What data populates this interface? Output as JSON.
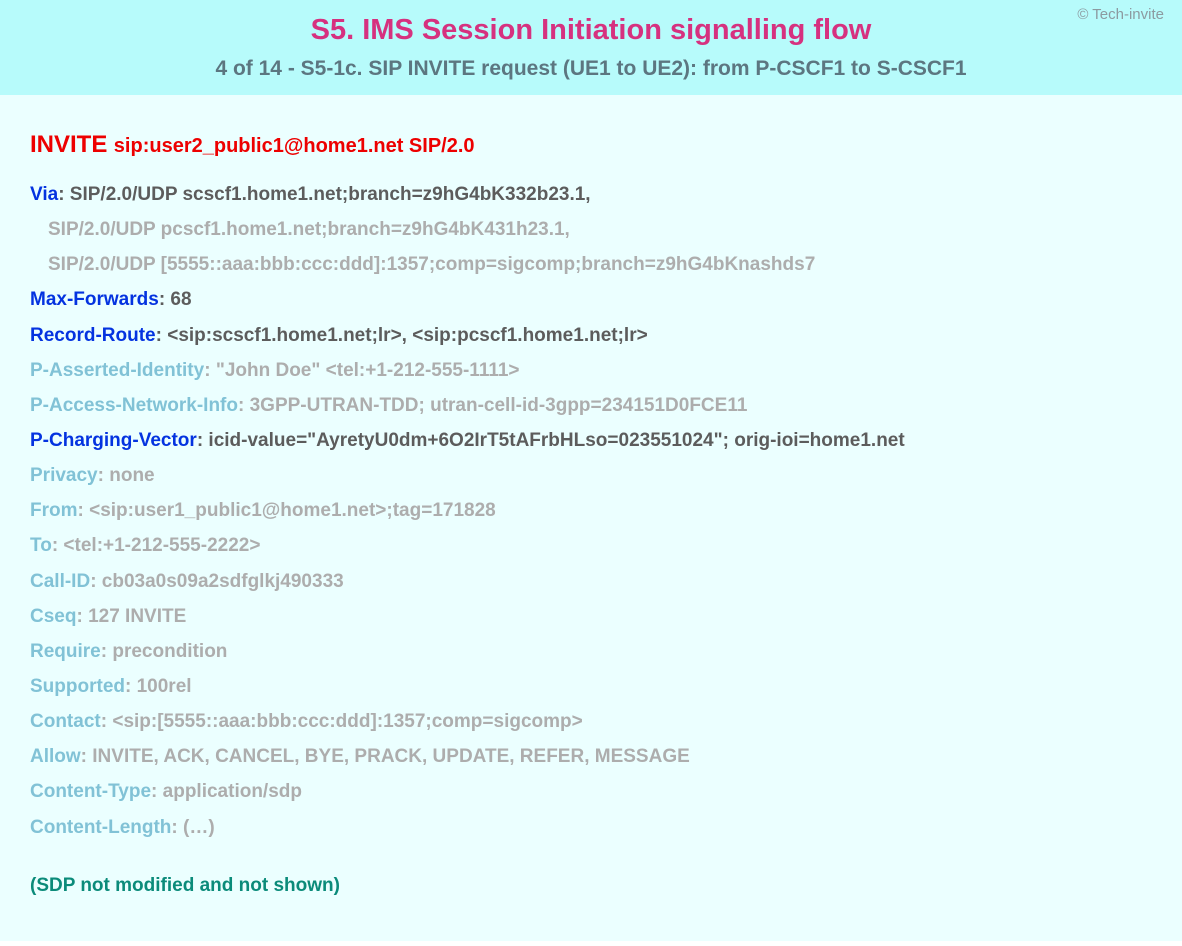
{
  "copyright": "© Tech-invite",
  "title_main": "S5. IMS Session Initiation signalling flow",
  "title_sub": "4 of 14 - S5-1c. SIP INVITE request (UE1 to UE2): from P-CSCF1 to S-CSCF1",
  "request": {
    "method": "INVITE",
    "uri": "sip:user2_public1@home1.net SIP/2.0"
  },
  "headers": [
    {
      "name": "Via",
      "value": "SIP/2.0/UDP scscf1.home1.net;branch=z9hG4bK332b23.1,",
      "nstyle": "k-blue",
      "vstyle": "v-dark",
      "colon": "colon-dark",
      "cont": false
    },
    {
      "name": "",
      "value": "SIP/2.0/UDP pcscf1.home1.net;branch=z9hG4bK431h23.1,",
      "nstyle": "",
      "vstyle": "v-grey",
      "colon": "",
      "cont": true
    },
    {
      "name": "",
      "value": "SIP/2.0/UDP [5555::aaa:bbb:ccc:ddd]:1357;comp=sigcomp;branch=z9hG4bKnashds7",
      "nstyle": "",
      "vstyle": "v-grey",
      "colon": "",
      "cont": true
    },
    {
      "name": "Max-Forwards",
      "value": "68",
      "nstyle": "k-blue",
      "vstyle": "v-dark",
      "colon": "colon-dark",
      "cont": false
    },
    {
      "name": "Record-Route",
      "value": "<sip:scscf1.home1.net;lr>, <sip:pcscf1.home1.net;lr>",
      "nstyle": "k-blue",
      "vstyle": "v-dark",
      "colon": "colon-dark",
      "cont": false
    },
    {
      "name": "P-Asserted-Identity",
      "value": "\"John Doe\" <tel:+1-212-555-1111>",
      "nstyle": "k-light",
      "vstyle": "v-grey",
      "colon": "colon-grey",
      "cont": false
    },
    {
      "name": "P-Access-Network-Info",
      "value": "3GPP-UTRAN-TDD; utran-cell-id-3gpp=234151D0FCE11",
      "nstyle": "k-light",
      "vstyle": "v-grey",
      "colon": "colon-grey",
      "cont": false
    },
    {
      "name": "P-Charging-Vector",
      "value": "icid-value=\"AyretyU0dm+6O2IrT5tAFrbHLso=023551024\"; orig-ioi=home1.net",
      "nstyle": "k-blue",
      "vstyle": "v-dark",
      "colon": "colon-dark",
      "cont": false
    },
    {
      "name": "Privacy",
      "value": "none",
      "nstyle": "k-light",
      "vstyle": "v-grey",
      "colon": "colon-grey",
      "cont": false
    },
    {
      "name": "From",
      "value": "<sip:user1_public1@home1.net>;tag=171828",
      "nstyle": "k-light",
      "vstyle": "v-grey",
      "colon": "colon-grey",
      "cont": false
    },
    {
      "name": "To",
      "value": "<tel:+1-212-555-2222>",
      "nstyle": "k-light",
      "vstyle": "v-grey",
      "colon": "colon-grey",
      "cont": false
    },
    {
      "name": "Call-ID",
      "value": "cb03a0s09a2sdfglkj490333",
      "nstyle": "k-light",
      "vstyle": "v-grey",
      "colon": "colon-grey",
      "cont": false
    },
    {
      "name": "Cseq",
      "value": "127 INVITE",
      "nstyle": "k-light",
      "vstyle": "v-grey",
      "colon": "colon-grey",
      "cont": false
    },
    {
      "name": "Require",
      "value": "precondition",
      "nstyle": "k-light",
      "vstyle": "v-grey",
      "colon": "colon-grey",
      "cont": false
    },
    {
      "name": "Supported",
      "value": "100rel",
      "nstyle": "k-light",
      "vstyle": "v-grey",
      "colon": "colon-grey",
      "cont": false
    },
    {
      "name": "Contact",
      "value": "<sip:[5555::aaa:bbb:ccc:ddd]:1357;comp=sigcomp>",
      "nstyle": "k-light",
      "vstyle": "v-grey",
      "colon": "colon-grey",
      "cont": false
    },
    {
      "name": "Allow",
      "value": "INVITE, ACK, CANCEL, BYE, PRACK, UPDATE, REFER, MESSAGE",
      "nstyle": "k-light",
      "vstyle": "v-grey",
      "colon": "colon-grey",
      "cont": false
    },
    {
      "name": "Content-Type",
      "value": "application/sdp",
      "nstyle": "k-light",
      "vstyle": "v-grey",
      "colon": "colon-grey",
      "cont": false
    },
    {
      "name": "Content-Length",
      "value": "(…)",
      "nstyle": "k-light",
      "vstyle": "v-grey",
      "colon": "colon-grey",
      "cont": false
    }
  ],
  "sdp_note": "(SDP not modified and not shown)"
}
